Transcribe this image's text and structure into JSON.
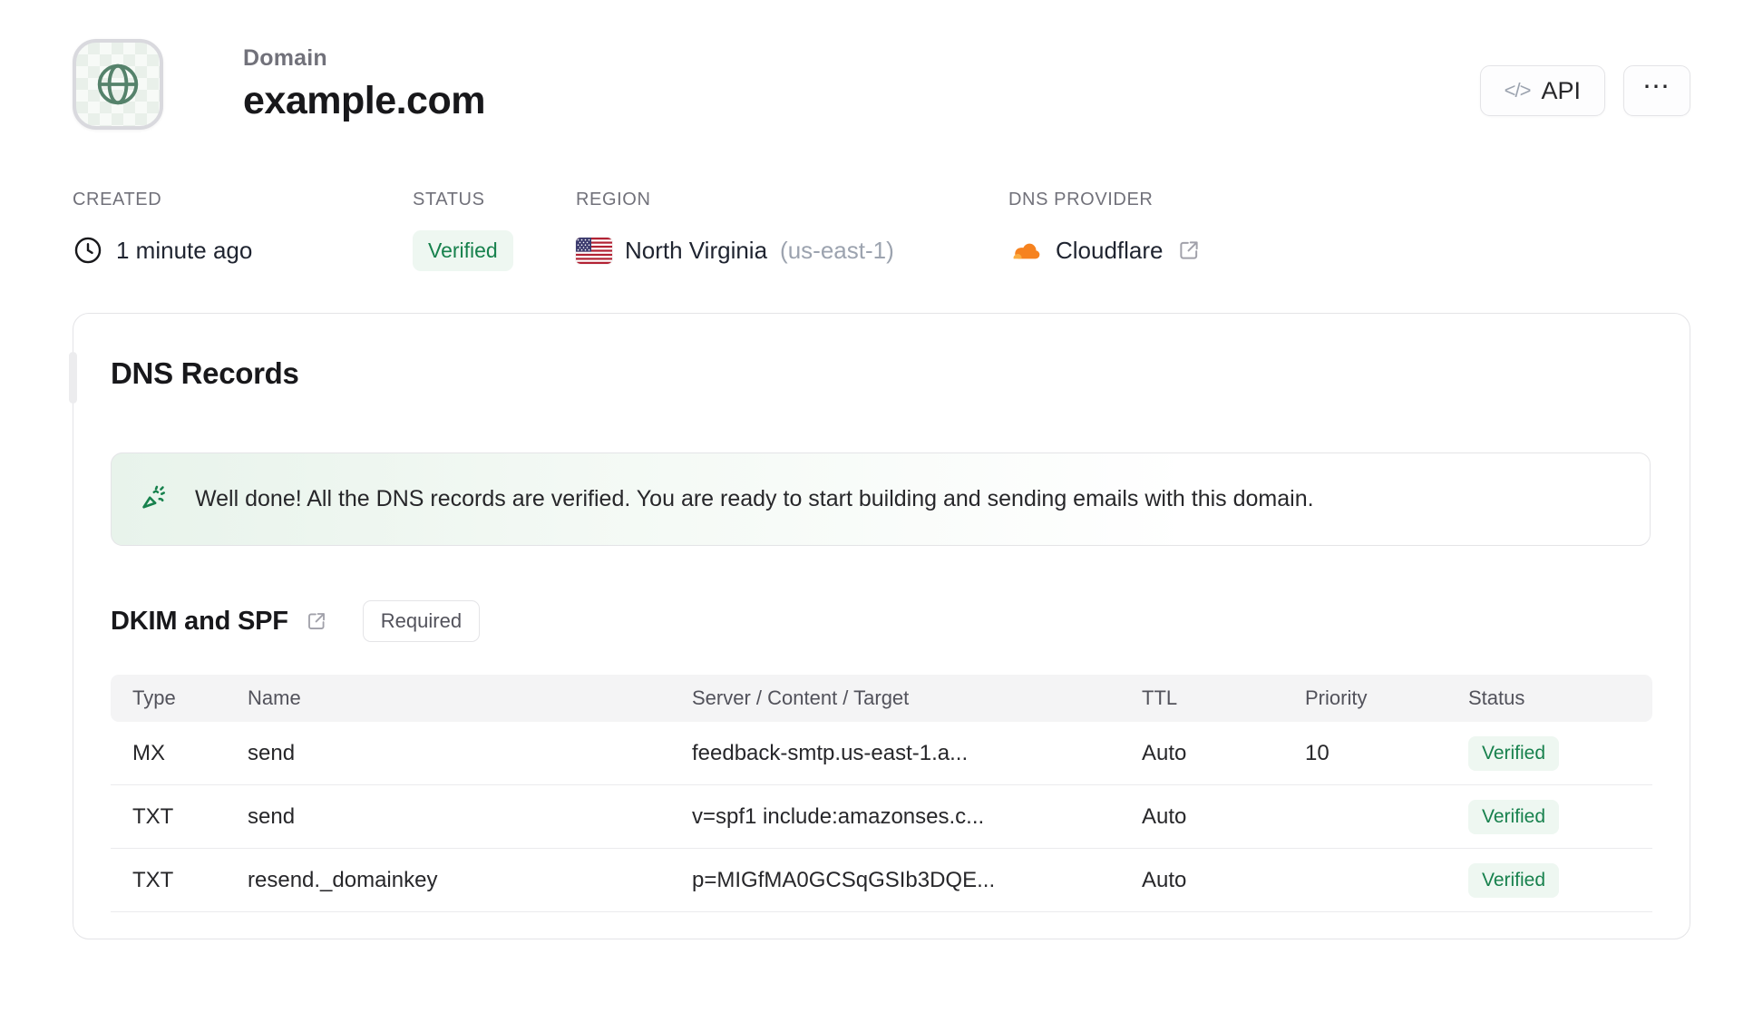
{
  "colors": {
    "accent_green": "#17814d",
    "badge_green_bg": "#eef7f1",
    "cloudflare_orange": "#f6821f",
    "flag_red": "#b22234",
    "flag_blue": "#3c3b6e"
  },
  "header": {
    "eyebrow": "Domain",
    "title": "example.com",
    "api_button_icon": "</>",
    "api_button_label": "API",
    "more_button_label": "⋯"
  },
  "meta": {
    "created_label": "CREATED",
    "created_value": "1 minute ago",
    "status_label": "STATUS",
    "status_value": "Verified",
    "region_label": "REGION",
    "region_value": "North Virginia",
    "region_code": "(us-east-1)",
    "dns_provider_label": "DNS PROVIDER",
    "dns_provider_value": "Cloudflare"
  },
  "dns_card": {
    "title": "DNS Records",
    "banner_message": "Well done! All the DNS records are verified. You are ready to start building and sending emails with this domain.",
    "dkim_section_title": "DKIM and SPF",
    "required_badge": "Required",
    "table": {
      "headers": [
        "Type",
        "Name",
        "Server / Content / Target",
        "TTL",
        "Priority",
        "Status"
      ],
      "rows": [
        {
          "type": "MX",
          "name": "send",
          "content": "feedback-smtp.us-east-1.a...",
          "ttl": "Auto",
          "priority": "10",
          "status": "Verified"
        },
        {
          "type": "TXT",
          "name": "send",
          "content": "v=spf1 include:amazonses.c...",
          "ttl": "Auto",
          "priority": "",
          "status": "Verified"
        },
        {
          "type": "TXT",
          "name": "resend._domainkey",
          "content": "p=MIGfMA0GCSqGSIb3DQE...",
          "ttl": "Auto",
          "priority": "",
          "status": "Verified"
        }
      ]
    }
  }
}
